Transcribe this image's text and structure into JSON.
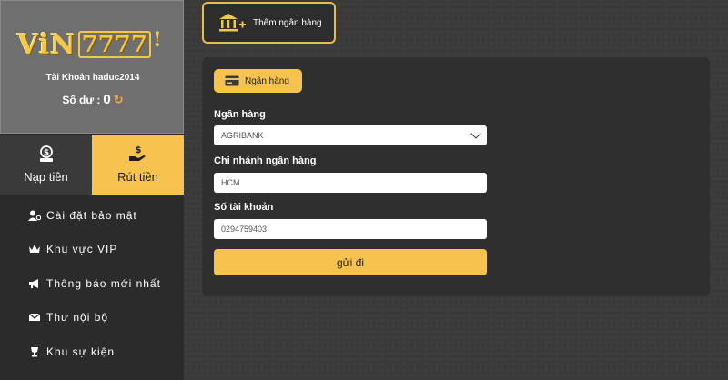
{
  "profile": {
    "logo_text": "ViN",
    "logo_box_text": "7777",
    "logo_mark": "!",
    "account_label": "Tài Khoản haduc2014",
    "balance_label": "Số dư :",
    "balance_value": "0",
    "refresh_icon": "refresh-icon"
  },
  "actions": {
    "deposit_label": "Nạp tiền",
    "withdraw_label": "Rút tiền"
  },
  "menu": [
    {
      "label": "Cài đặt bảo mật",
      "icon": "user-gear-icon"
    },
    {
      "label": "Khu vực VIP",
      "icon": "crown-icon"
    },
    {
      "label": "Thông báo mới nhất",
      "icon": "megaphone-icon"
    },
    {
      "label": "Thư nội bộ",
      "icon": "envelope-icon"
    },
    {
      "label": "Khu sự kiện",
      "icon": "trophy-icon"
    }
  ],
  "add_bank": {
    "label": "Thêm ngân hàng"
  },
  "panel": {
    "tab_label": "Ngân hàng",
    "bank_label": "Ngân hàng",
    "bank_value": "AGRIBANK",
    "branch_label": "Chi nhánh ngân hàng",
    "branch_value": "HCM",
    "account_label": "Số tài khoản",
    "account_value": "0294759403",
    "submit_label": "gửi đi"
  },
  "colors": {
    "accent": "#f7c24d",
    "panel": "#2f2f2f",
    "sidebar": "#2b2b2b"
  }
}
